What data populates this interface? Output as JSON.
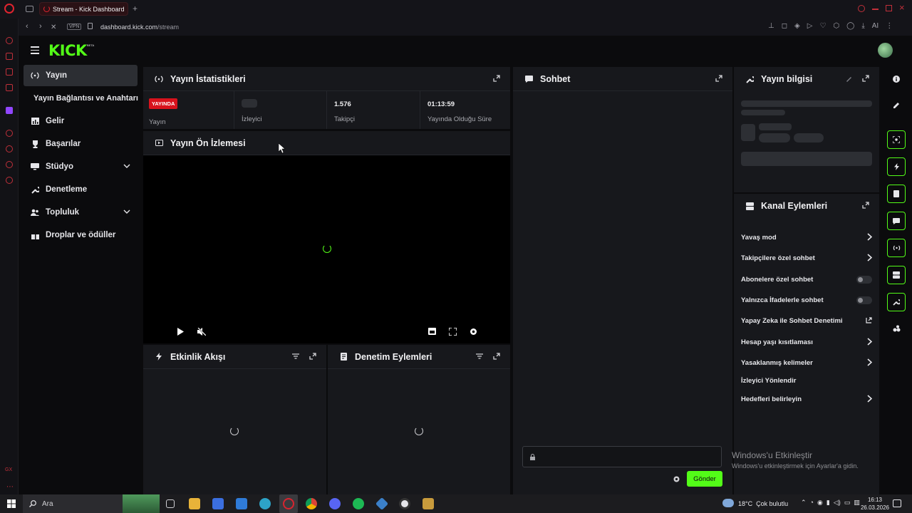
{
  "browser": {
    "tab_title": "Stream - Kick Dashboard",
    "url_host": "dashboard.kick.com",
    "url_path": "/stream",
    "vpn_label": "VPN",
    "ai_label": "AI"
  },
  "brand": {
    "logo": "KICK",
    "beta": "BETA",
    "accent": "#53fc18"
  },
  "sidebar": {
    "items": [
      {
        "label": "Yayın",
        "icon": "broadcast-icon",
        "active": true
      },
      {
        "label": "Yayın Bağlantısı ve Anahtarı",
        "icon": "",
        "active": false
      },
      {
        "label": "Gelir",
        "icon": "chart-icon",
        "active": false
      },
      {
        "label": "Başarılar",
        "icon": "trophy-icon",
        "active": false
      },
      {
        "label": "Stüdyo",
        "icon": "monitor-icon",
        "active": false
      },
      {
        "label": "Denetleme",
        "icon": "wrench-icon",
        "active": false
      },
      {
        "label": "Topluluk",
        "icon": "people-icon",
        "active": false
      },
      {
        "label": "Droplar ve ödüller",
        "icon": "gift-icon",
        "active": false
      }
    ]
  },
  "stats": {
    "title": "Yayın İstatistikleri",
    "live_badge": "YAYINDA",
    "cells": [
      {
        "value": "",
        "label": "Yayın"
      },
      {
        "value": "",
        "label": "İzleyici"
      },
      {
        "value": "1.576",
        "label": "Takipçi"
      },
      {
        "value": "01:13:59",
        "label": "Yayında Olduğu Süre"
      }
    ]
  },
  "preview": {
    "title": "Yayın Ön İzlemesi"
  },
  "activity": {
    "title": "Etkinlik Akışı"
  },
  "moderation_actions": {
    "title": "Denetim Eylemleri"
  },
  "chat": {
    "title": "Sohbet",
    "send_label": "Gönder"
  },
  "stream_info": {
    "title": "Yayın bilgisi"
  },
  "channel_actions": {
    "title": "Kanal Eylemleri",
    "rows": [
      {
        "label": "Yavaş mod",
        "control": "arrow"
      },
      {
        "label": "Takipçilere özel sohbet",
        "control": "arrow"
      },
      {
        "label": "Abonelere özel sohbet",
        "control": "toggle"
      },
      {
        "label": "Yalnızca İfadelerle sohbet",
        "control": "toggle"
      },
      {
        "label": "Yapay Zeka ile Sohbet Denetimi",
        "control": "external"
      },
      {
        "label": "Hesap yaşı kısıtlaması",
        "control": "arrow"
      },
      {
        "label": "Yasaklanmış kelimeler",
        "control": "arrow"
      },
      {
        "label": "İzleyici Yönlendir",
        "control": "none"
      },
      {
        "label": "Hedefleri belirleyin",
        "control": "arrow"
      }
    ]
  },
  "watermark": {
    "line1": "Windows'u Etkinleştir",
    "line2": "Windows'u etkinleştirmek için Ayarlar'a gidin."
  },
  "taskbar": {
    "search_placeholder": "Ara",
    "weather": "18°C  Çok bulutlu",
    "time": "16:13",
    "date": "26.03.2026"
  }
}
